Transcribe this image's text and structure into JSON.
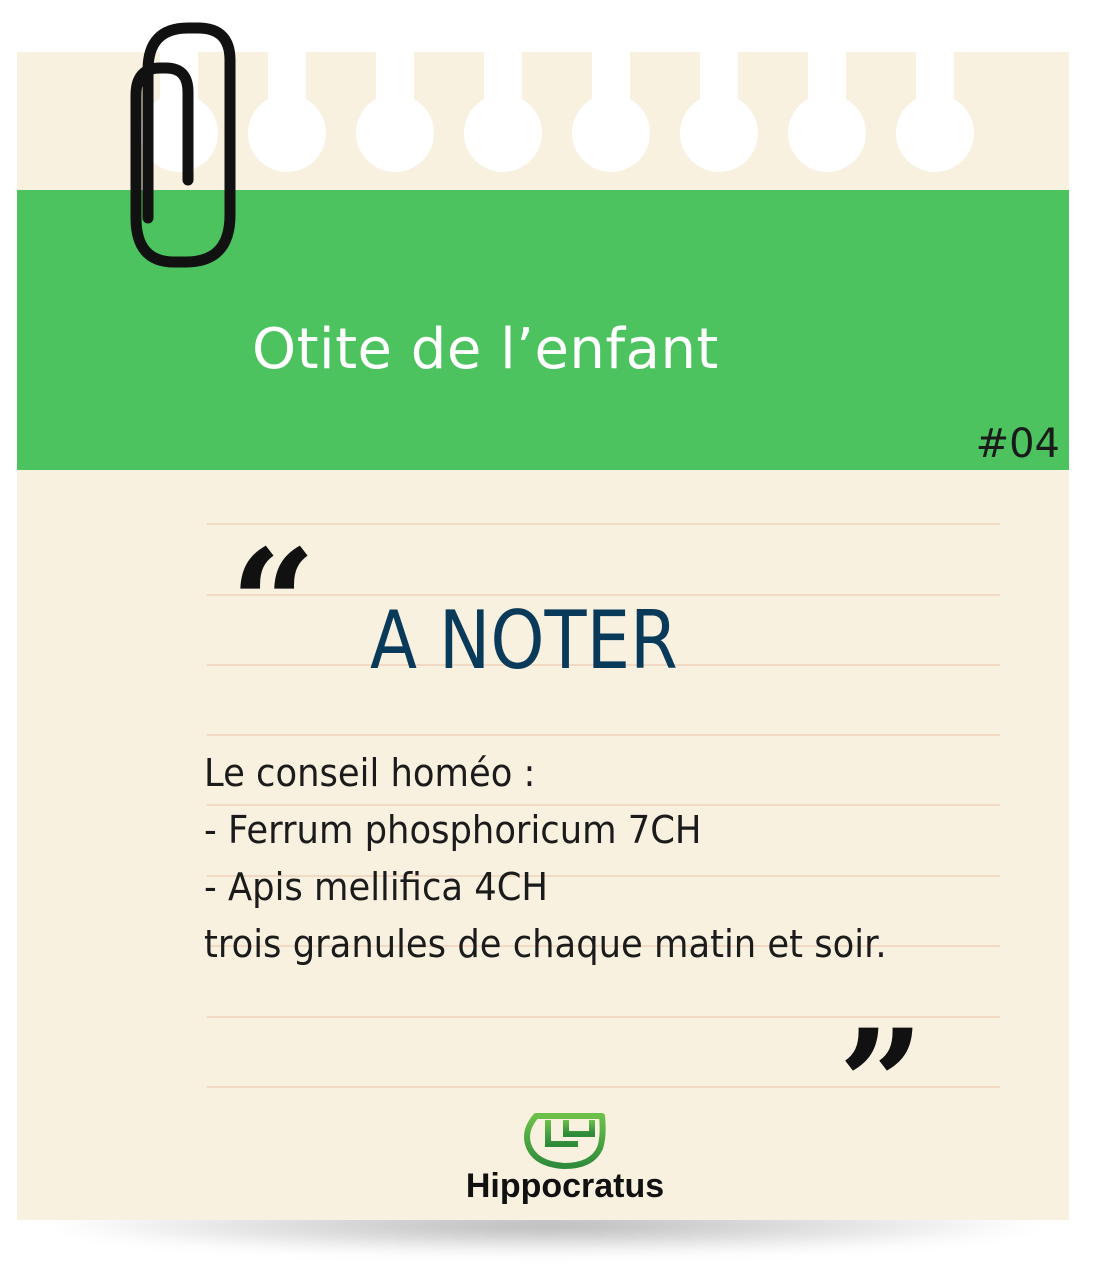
{
  "note": {
    "title": "Otite de l’enfant",
    "number": "#04",
    "heading": "A NOTER",
    "body_lines": [
      "Le conseil homéo :",
      "- Ferrum phosphoricum 7CH",
      "- Apis mellifica 4CH",
      "trois granules de chaque matin et soir."
    ],
    "quote_open": "“",
    "quote_close": "”"
  },
  "brand": {
    "name": "Hippocratus",
    "icon": "leaf-logo-icon"
  },
  "decor": {
    "clip_icon": "paperclip-icon"
  },
  "colors": {
    "paper": "#f8f1df",
    "band": "#4cc35f",
    "heading": "#0a3a5a",
    "rule": "#f1d9c3",
    "logo_green": "#3da043"
  }
}
